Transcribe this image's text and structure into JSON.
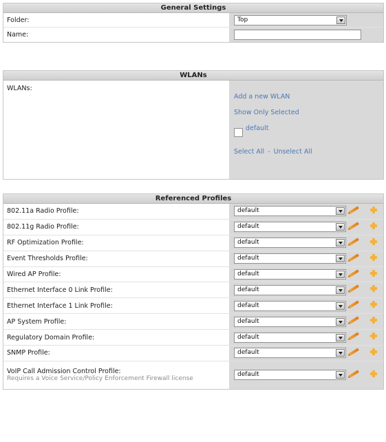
{
  "general": {
    "header": "General Settings",
    "folder_label": "Folder:",
    "folder_value": "Top",
    "name_label": "Name:",
    "name_value": ""
  },
  "wlans": {
    "header": "WLANs",
    "label": "WLANs:",
    "add_link": "Add a new WLAN",
    "show_selected_link": "Show Only Selected",
    "default_checkbox_label": "default",
    "default_checked": false,
    "select_all": "Select All",
    "separator": "-",
    "unselect_all": "Unselect All"
  },
  "profiles": {
    "header": "Referenced Profiles",
    "rows": [
      {
        "label": "802.11a Radio Profile:",
        "value": "default"
      },
      {
        "label": "802.11g Radio Profile:",
        "value": "default"
      },
      {
        "label": "RF Optimization Profile:",
        "value": "default"
      },
      {
        "label": "Event Thresholds Profile:",
        "value": "default"
      },
      {
        "label": "Wired AP Profile:",
        "value": "default"
      },
      {
        "label": "Ethernet Interface 0 Link Profile:",
        "value": "default"
      },
      {
        "label": "Ethernet Interface 1 Link Profile:",
        "value": "default"
      },
      {
        "label": "AP System Profile:",
        "value": "default"
      },
      {
        "label": "Regulatory Domain Profile:",
        "value": "default"
      },
      {
        "label": "SNMP Profile:",
        "value": "default"
      },
      {
        "label": "VoIP Call Admission Control Profile:",
        "note": "Requires a Voice Service/Policy Enforcement Firewall license",
        "value": "default"
      }
    ]
  },
  "icons": {
    "dropdown": "chevron-down-icon",
    "edit": "pencil-icon",
    "add": "plus-icon"
  },
  "colors": {
    "header_bg": "#d6d6d6",
    "value_bg": "#d9d9d9",
    "link": "#4a78b8",
    "edit_icon": "#e88b25",
    "add_icon": "#f2b23d"
  }
}
